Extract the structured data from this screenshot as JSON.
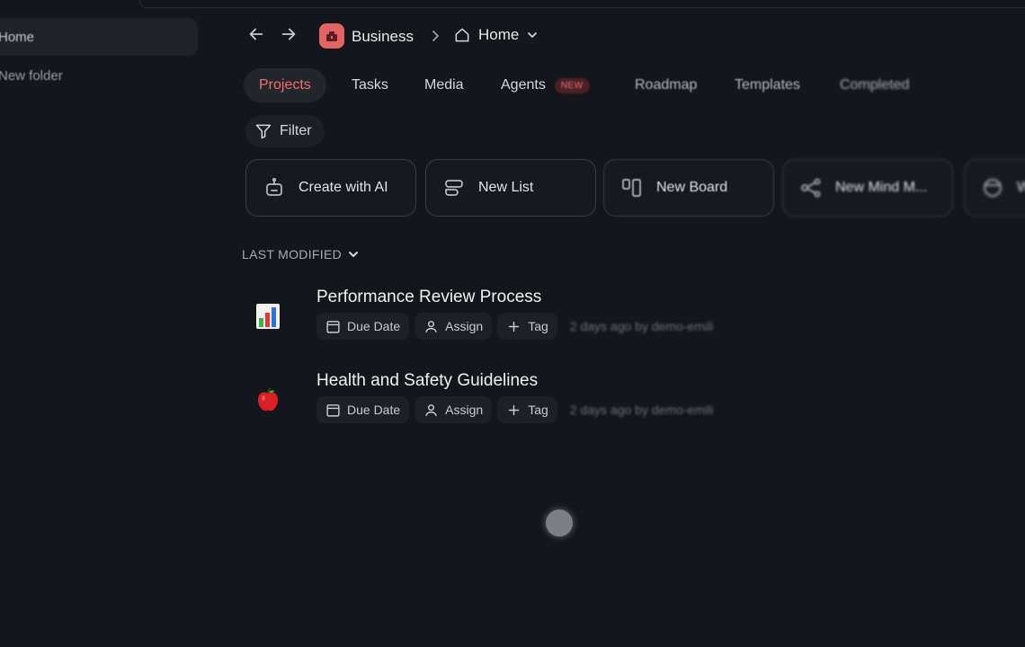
{
  "sidebar": {
    "items": [
      {
        "label": "Home",
        "active": true
      },
      {
        "label": "New folder",
        "active": false
      }
    ]
  },
  "header": {
    "workspace": "Business",
    "page": "Home",
    "icons": [
      "arrow-left-icon",
      "arrow-right-icon",
      "workspace-icon",
      "chevron-right-icon",
      "home-icon",
      "chevron-down-icon"
    ]
  },
  "tabs": [
    {
      "label": "Projects",
      "active": true
    },
    {
      "label": "Tasks"
    },
    {
      "label": "Media"
    },
    {
      "label": "Agents",
      "badge": "NEW"
    },
    {
      "label": "Roadmap"
    },
    {
      "label": "Templates"
    },
    {
      "label": "Completed"
    }
  ],
  "filter": {
    "label": "Filter"
  },
  "create_cards": [
    {
      "label": "Create with AI",
      "icon": "robot-icon"
    },
    {
      "label": "New List",
      "icon": "list-icon"
    },
    {
      "label": "New Board",
      "icon": "board-icon"
    },
    {
      "label": "New Mind M...",
      "icon": "mindmap-icon"
    },
    {
      "label": "W",
      "icon": "template-icon"
    }
  ],
  "sort": {
    "label": "LAST MODIFIED"
  },
  "projects": [
    {
      "title": "Performance Review Process",
      "emoji": "bar-chart-icon",
      "due": "Due Date",
      "assign": "Assign",
      "tag": "Tag",
      "modified": "2 days ago by demo-emili"
    },
    {
      "title": "Health and Safety Guidelines",
      "emoji": "apple-icon",
      "due": "Due Date",
      "assign": "Assign",
      "tag": "Tag",
      "modified": "2 days ago by demo-emili"
    }
  ],
  "colors": {
    "background": "#14161b",
    "accent": "#f07070",
    "workspace": "#e26464"
  }
}
